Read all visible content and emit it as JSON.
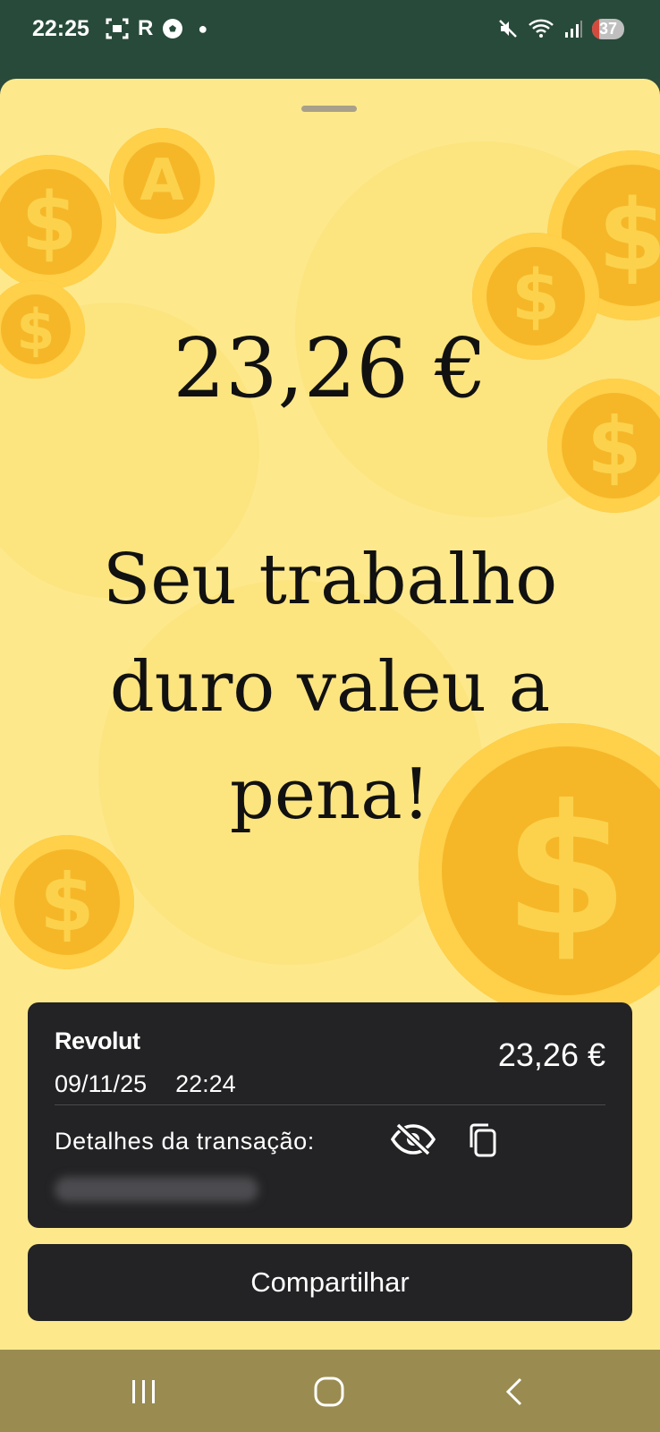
{
  "status_bar": {
    "time": "22:25",
    "left_icons": [
      "screenshot-icon",
      "revolut-r-icon",
      "football-icon",
      "dot-icon"
    ],
    "right_icons": [
      "mute-icon",
      "wifi-icon",
      "signal-icon"
    ],
    "battery": "37"
  },
  "hero": {
    "amount": "23,26 €",
    "headline": "Seu trabalho duro valeu a pena!"
  },
  "card": {
    "brand": "Revolut",
    "date": "09/11/25",
    "time": "22:24",
    "amount": "23,26 €",
    "details_label": "Detalhes da transação:"
  },
  "share_button": {
    "label": "Compartilhar"
  },
  "colors": {
    "sheet_background": "#fde98c",
    "card_background": "#232325",
    "status_bar": "#284a3a",
    "nav_bar": "#9a8c50",
    "coin": "#f5b728"
  }
}
